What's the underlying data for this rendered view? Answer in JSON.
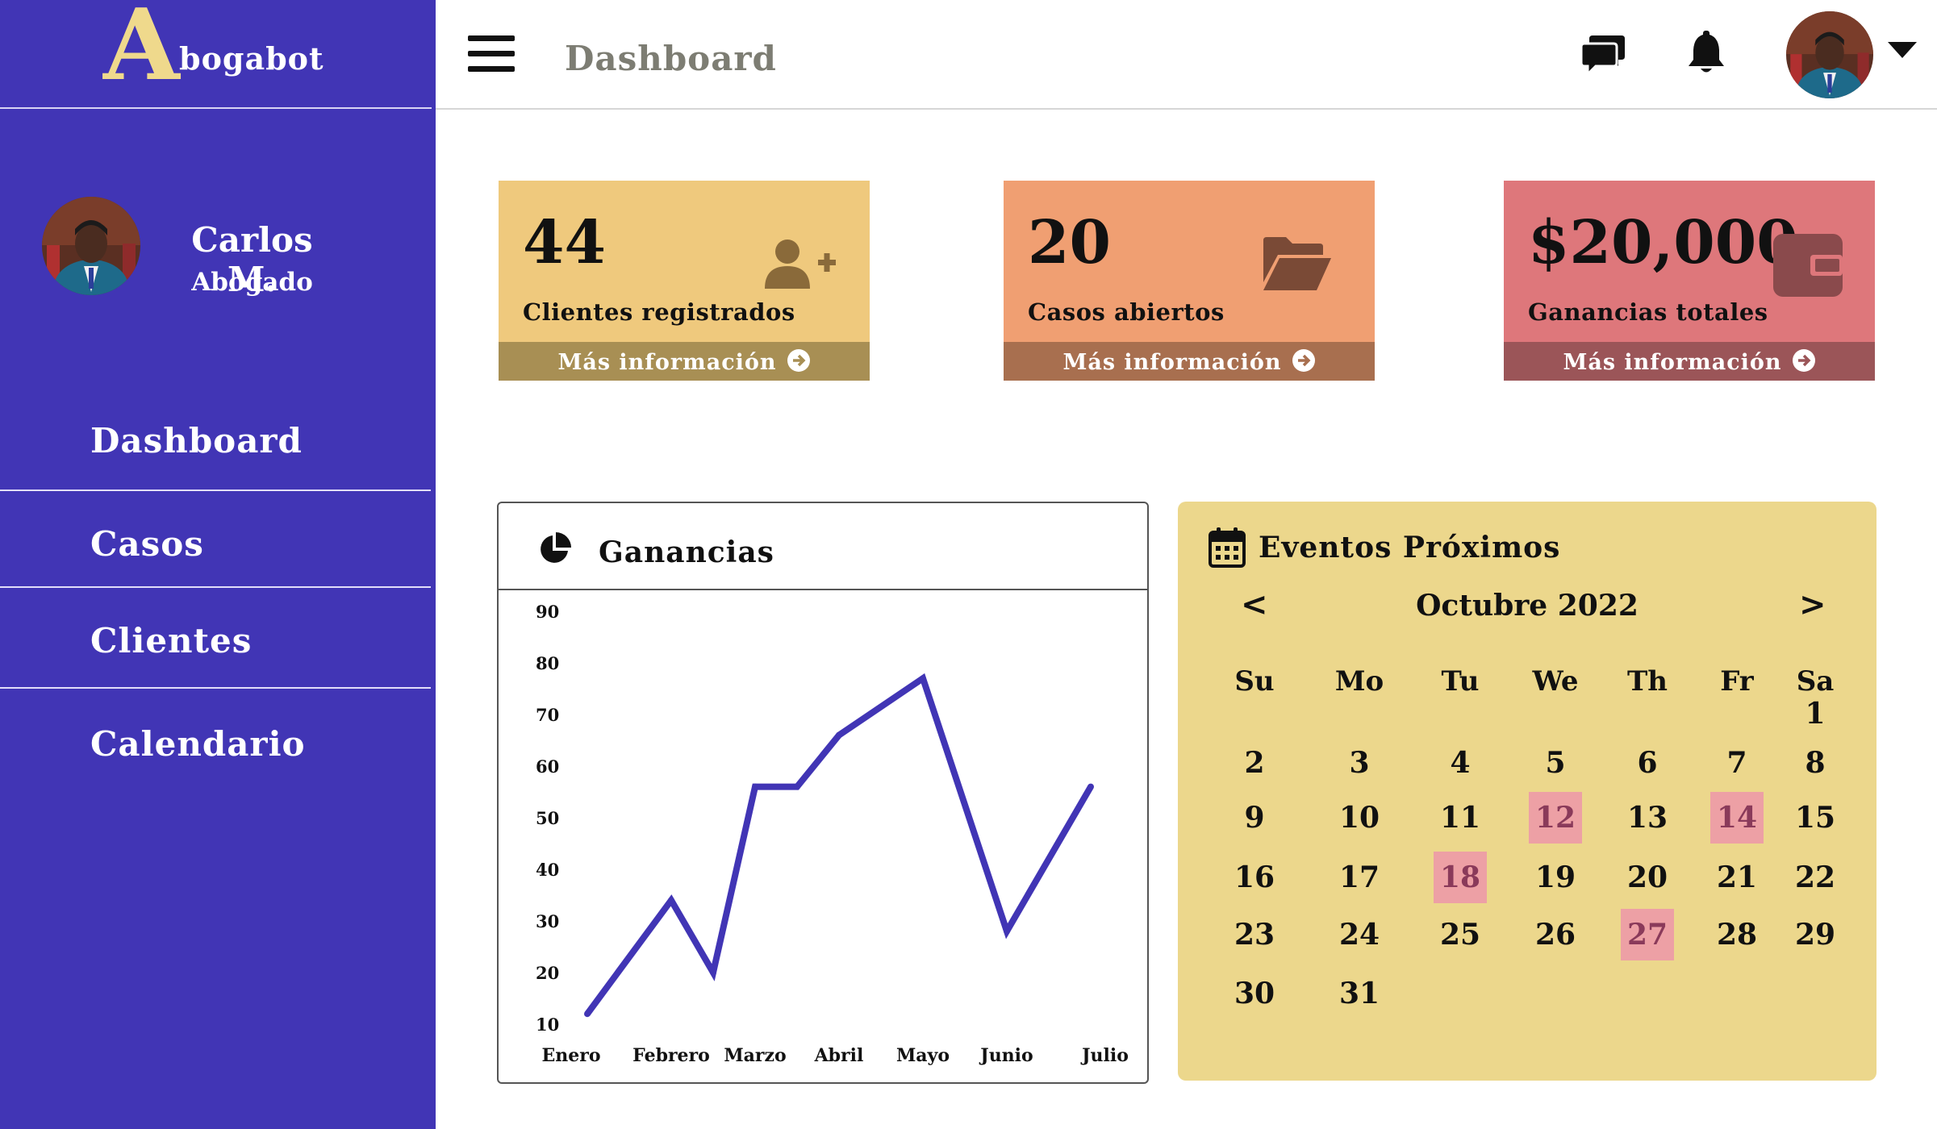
{
  "brand": {
    "initial": "A",
    "rest": "bogabot"
  },
  "profile": {
    "name": "Carlos M.",
    "role": "Abogado"
  },
  "nav": [
    {
      "label": "Dashboard"
    },
    {
      "label": "Casos"
    },
    {
      "label": "Clientes"
    },
    {
      "label": "Calendario"
    }
  ],
  "topbar": {
    "title": "Dashboard",
    "icons": [
      "menu-icon",
      "chat-icon",
      "bell-icon",
      "chevron-down-icon"
    ]
  },
  "cards": [
    {
      "value": "44",
      "label": "Clientes registrados",
      "footer": "Más información",
      "icon": "add-user-icon",
      "color": "#efc97d",
      "footer_color": "#a88f54"
    },
    {
      "value": "20",
      "label": "Casos abiertos",
      "footer": "Más información",
      "icon": "folder-open-icon",
      "color": "#f09f72",
      "footer_color": "#a86f4f"
    },
    {
      "value": "$20,000",
      "label": "Ganancias totales",
      "footer": "Más información",
      "icon": "wallet-icon",
      "color": "#de777b",
      "footer_color": "#9b5558"
    }
  ],
  "chart_panel": {
    "title": "Ganancias",
    "icon": "pie-chart-icon"
  },
  "chart_data": {
    "type": "line",
    "title": "Ganancias",
    "categories": [
      "Enero",
      "Febrero",
      "Marzo",
      "Abril",
      "Mayo",
      "Junio",
      "Julio"
    ],
    "x": [
      1,
      2,
      2.5,
      3,
      3.5,
      4,
      5,
      6,
      7
    ],
    "values": [
      12,
      34,
      20,
      56,
      56,
      66,
      77,
      28,
      56
    ],
    "yticks": [
      10,
      20,
      30,
      40,
      50,
      60,
      70,
      80,
      90
    ],
    "ylim": [
      10,
      90
    ],
    "xlabel": "",
    "ylabel": "",
    "grid": false,
    "color": "#4135b5"
  },
  "calendar": {
    "title": "Eventos Próximos",
    "icon": "calendar-icon",
    "month": "Octubre 2022",
    "prev": "<",
    "next": ">",
    "weekdays": [
      "Su",
      "Mo",
      "Tu",
      "We",
      "Th",
      "Fr",
      "Sa"
    ],
    "first_weekday": 6,
    "days_in_month": 31,
    "event_days": [
      12,
      14,
      18,
      27
    ],
    "event_color": "#eda0a5"
  },
  "colors": {
    "sidebar": "#4135b5",
    "brand_accent": "#efd98c",
    "calendar_bg": "#ecd78c"
  }
}
